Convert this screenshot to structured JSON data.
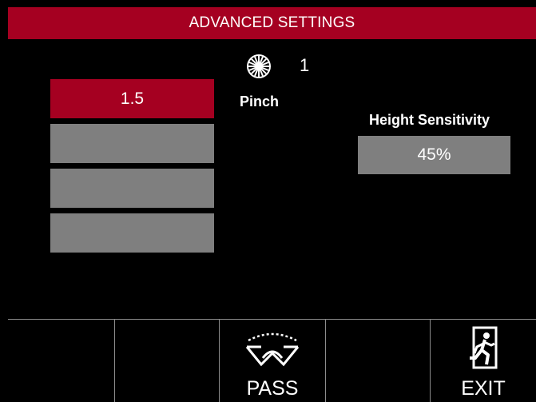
{
  "header": {
    "title": "ADVANCED SETTINGS"
  },
  "status": {
    "wheel_icon": "wheel-icon",
    "count": "1"
  },
  "pinch": {
    "label": "Pinch",
    "options": [
      {
        "label": "1.5",
        "selected": true
      },
      {
        "label": "",
        "selected": false
      },
      {
        "label": "",
        "selected": false
      },
      {
        "label": "",
        "selected": false
      }
    ]
  },
  "height_sensitivity": {
    "label": "Height Sensitivity",
    "value": "45%"
  },
  "footer": {
    "buttons": [
      {
        "label": "",
        "icon": ""
      },
      {
        "label": "",
        "icon": ""
      },
      {
        "label": "PASS",
        "icon": "pass-icon"
      },
      {
        "label": "",
        "icon": ""
      },
      {
        "label": "EXIT",
        "icon": "exit-icon"
      }
    ]
  },
  "colors": {
    "accent": "#a50021",
    "button_gray": "#7f7f7f",
    "background": "#000000"
  }
}
